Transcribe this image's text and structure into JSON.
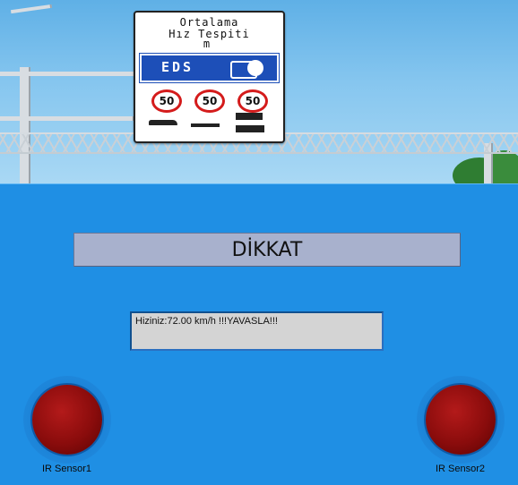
{
  "sign": {
    "line1": "Ortalama",
    "line2": "Hız Tespiti",
    "line3": "m",
    "eds_label": "EDS",
    "speed_limits": [
      "50",
      "50",
      "50"
    ],
    "icon": "speed-camera-icon"
  },
  "panel": {
    "warning_title": "DİKKAT",
    "speed_message": "Hiziniz:72.00 km/h   !!!YAVASLA!!!",
    "sensor1_label": "IR Sensor1",
    "sensor2_label": "IR Sensor2",
    "led_color": "#8a0c0c",
    "background_color": "#1f8fe4"
  }
}
